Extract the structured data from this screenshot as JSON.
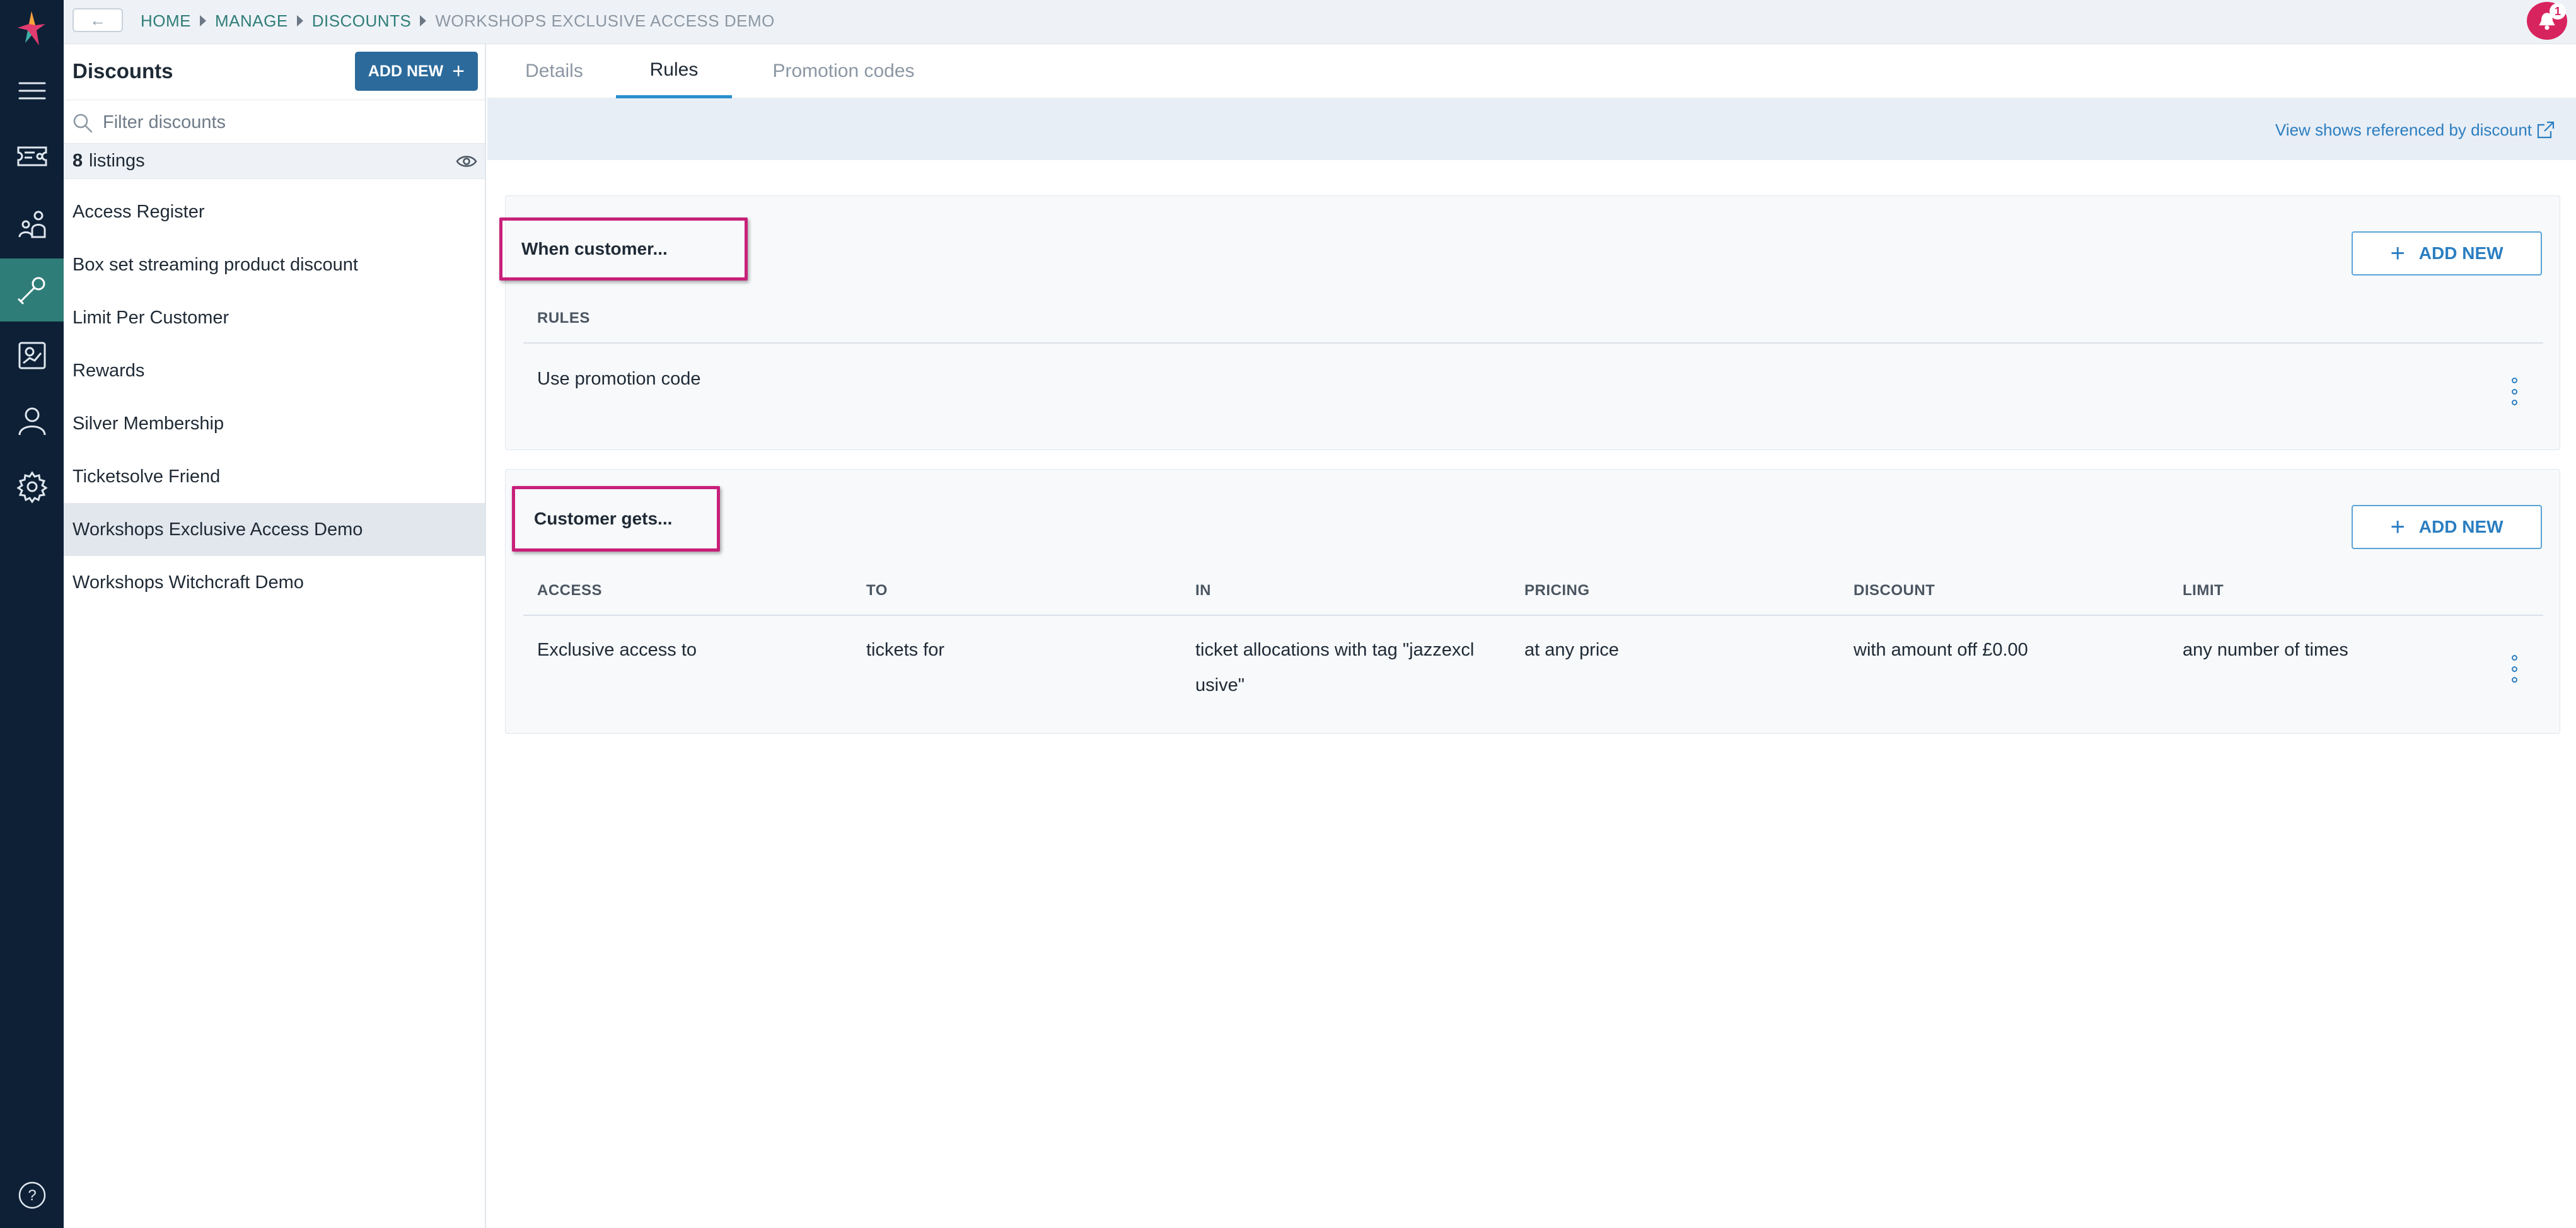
{
  "breadcrumb": {
    "back_label": "←",
    "items": [
      "HOME",
      "MANAGE",
      "DISCOUNTS",
      "WORKSHOPS EXCLUSIVE ACCESS DEMO"
    ]
  },
  "notifications": {
    "count": "1"
  },
  "sidebar": {
    "items": [
      "menu-icon",
      "tickets-icon",
      "audience-icon",
      "tools-icon",
      "reports-icon",
      "user-icon",
      "gear-icon"
    ],
    "active": "tools-icon",
    "help_label": "?"
  },
  "list_panel": {
    "title": "Discounts",
    "add_label": "ADD NEW",
    "search_placeholder": "Filter discounts",
    "count_number": "8",
    "count_label": "listings",
    "items": [
      "Access Register",
      "Box set streaming product discount",
      "Limit Per Customer",
      "Rewards",
      "Silver Membership",
      "Ticketsolve Friend",
      "Workshops Exclusive Access Demo",
      "Workshops Witchcraft Demo"
    ],
    "selected_index": 6
  },
  "tabs": [
    "Details",
    "Rules",
    "Promotion codes"
  ],
  "active_tab": "Rules",
  "link_bar": {
    "label": "View shows referenced by discount"
  },
  "when_card": {
    "title": "When customer...",
    "add_label": "ADD NEW",
    "column_header": "RULES",
    "rows": [
      "Use promotion code"
    ]
  },
  "gets_card": {
    "title": "Customer gets...",
    "add_label": "ADD NEW",
    "columns": [
      "ACCESS",
      "TO",
      "IN",
      "PRICING",
      "DISCOUNT",
      "LIMIT"
    ],
    "row": {
      "access": "Exclusive access to",
      "to": "tickets for",
      "in_line1": "ticket allocations with tag \"jazzexcl",
      "in_line2": "usive\"",
      "pricing": "at any price",
      "discount": "with amount off £0.00",
      "limit": "any number of times"
    }
  },
  "colors": {
    "rail": "#0d2036",
    "rail_active": "#2f7d78",
    "primary_button": "#2b6a9b",
    "link": "#2b7ec1",
    "highlight_box": "#c8207a",
    "notification": "#d8245e"
  }
}
